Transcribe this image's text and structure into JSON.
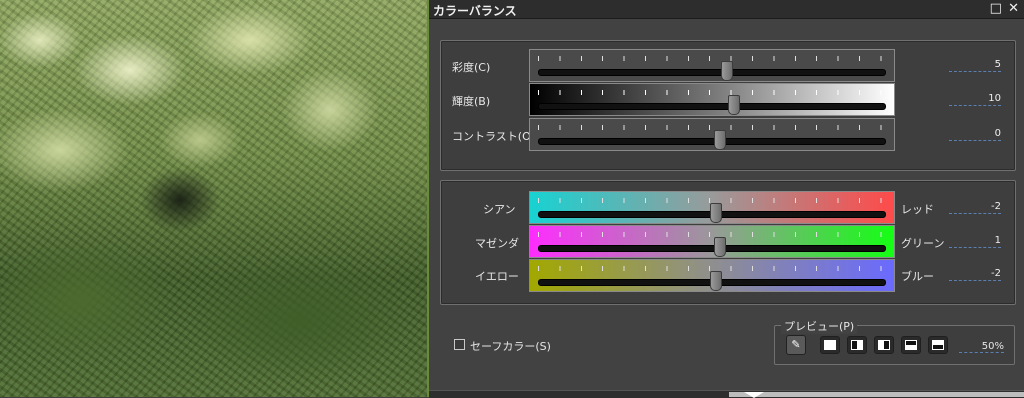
{
  "window": {
    "title": "カラーバランス",
    "restore_icon": "□",
    "close_icon": "✕"
  },
  "group1": {
    "saturation": {
      "label": "彩度(C)",
      "value": "5",
      "level": 0.54
    },
    "brightness": {
      "label": "輝度(B)",
      "value": "10",
      "level": 0.56
    },
    "contrast": {
      "label": "コントラスト(O)",
      "value": "0",
      "level": 0.52
    }
  },
  "group2": {
    "cyan_red": {
      "left_label": "シアン",
      "right_label": "レッド",
      "value": "-2",
      "level": 0.51
    },
    "magenta_green": {
      "left_label": "マゼンダ",
      "right_label": "グリーン",
      "value": "1",
      "level": 0.52
    },
    "yellow_blue": {
      "left_label": "イエロー",
      "right_label": "ブルー",
      "value": "-2",
      "level": 0.51
    }
  },
  "safe_color": {
    "label": "セーフカラー(S)",
    "checked": false
  },
  "preview": {
    "label": "プレビュー(P)",
    "zoom": "50%",
    "pen_icon": "✎",
    "buttons": [
      "preview-full-icon",
      "preview-split-left-icon",
      "preview-split-right-icon",
      "preview-split-top-icon",
      "preview-split-bottom-icon"
    ]
  },
  "colors": {
    "cyan": "#18d2d2",
    "red": "#ff4a4a",
    "magenta": "#ff2cff",
    "green": "#14ff14",
    "yellow": "#a2a800",
    "blue": "#6a6aff"
  }
}
